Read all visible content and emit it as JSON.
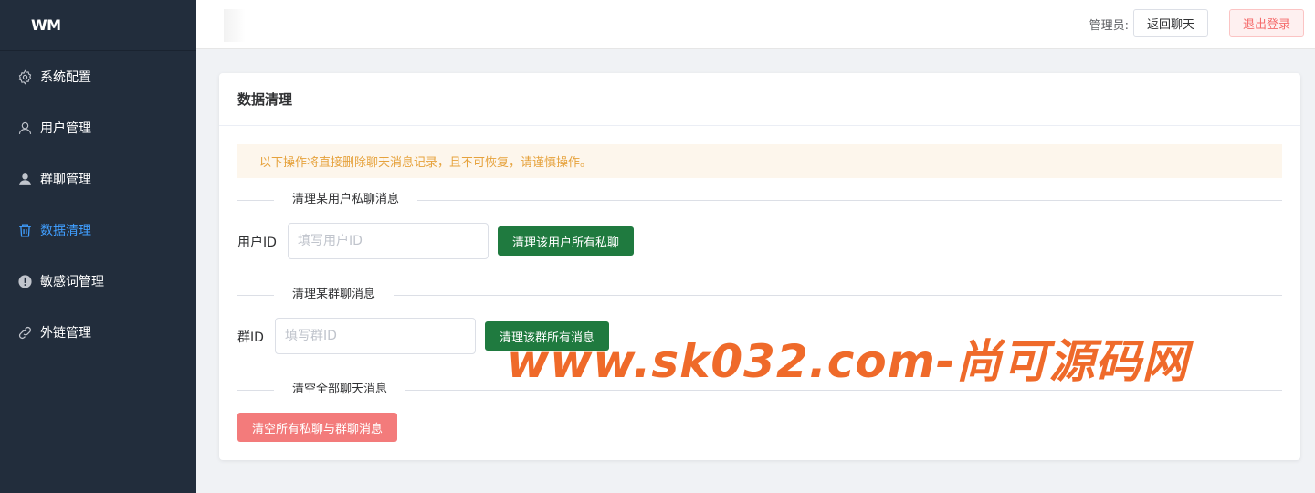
{
  "logo": {
    "text": "WM"
  },
  "sidebar": {
    "items": [
      {
        "label": "系统配置",
        "icon": "gear-icon"
      },
      {
        "label": "用户管理",
        "icon": "user-icon"
      },
      {
        "label": "群聊管理",
        "icon": "user-solid-icon"
      },
      {
        "label": "数据清理",
        "icon": "trash-icon",
        "active": true
      },
      {
        "label": "敏感词管理",
        "icon": "warning-icon"
      },
      {
        "label": "外链管理",
        "icon": "link-icon"
      }
    ]
  },
  "header": {
    "admin_label": "管理员:",
    "back_button": "返回聊天",
    "logout_button": "退出登录"
  },
  "card": {
    "title": "数据清理",
    "alert": "以下操作将直接删除聊天消息记录，且不可恢复，请谨慎操作。",
    "private_section": {
      "title": "清理某用户私聊消息",
      "label": "用户ID",
      "placeholder": "填写用户ID",
      "button": "清理该用户所有私聊"
    },
    "group_section": {
      "title": "清理某群聊消息",
      "label": "群ID",
      "placeholder": "填写群ID",
      "button": "清理该群所有消息"
    },
    "all_section": {
      "title": "清空全部聊天消息",
      "button": "清空所有私聊与群聊消息"
    }
  },
  "watermark": "www.sk032.com-尚可源码网",
  "colors": {
    "sidebar": "#222d3c",
    "active": "#409eff",
    "green": "#1f7a3f",
    "danger": "#f37b7b",
    "alert_bg": "#fdf6ec",
    "alert_text": "#e6a23c"
  }
}
